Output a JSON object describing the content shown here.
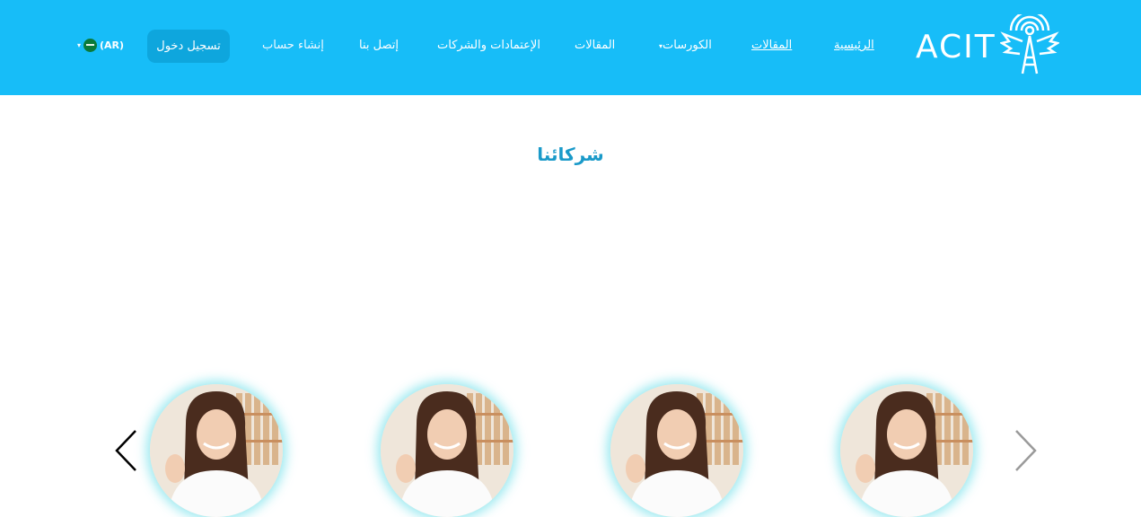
{
  "header": {
    "logo_text": "ACIT",
    "nav": {
      "home": "الرئيسية",
      "articles_link": "المقالات",
      "courses": "الكورسات",
      "articles": "المقالات",
      "accreditations": "الإعتمادات والشركات",
      "contact": "إتصل بنا",
      "register": "إنشاء حساب",
      "login": "تسجيل دخول"
    },
    "language": "(AR)"
  },
  "partners": {
    "title": "شركائنا"
  },
  "colors": {
    "header_bg": "#17bdf8",
    "title": "#1a9ac9",
    "login_bg": "#0ea6dd"
  }
}
